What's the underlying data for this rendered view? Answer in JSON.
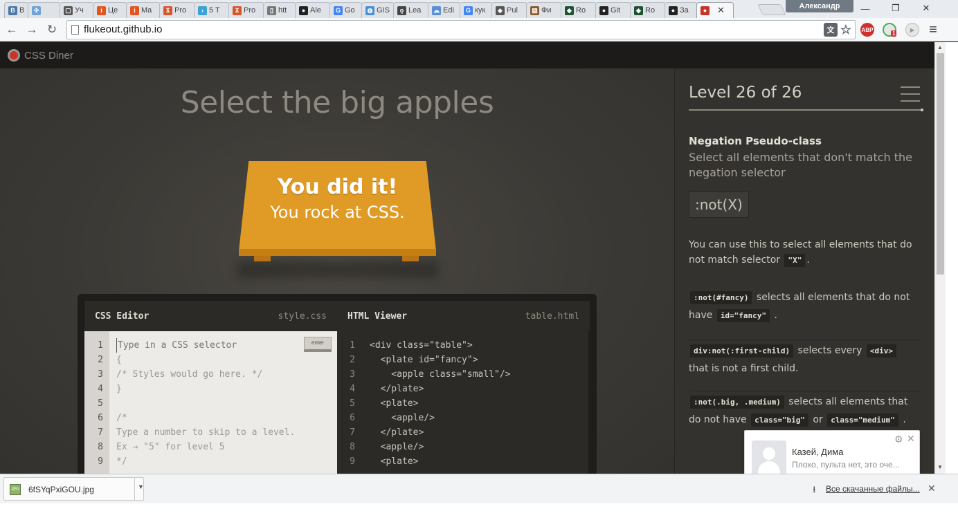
{
  "browser": {
    "tabs": [
      {
        "label": "В",
        "favicon_color": "#4a76a8",
        "favicon_char": "В"
      },
      {
        "label": "",
        "favicon_color": "#6aa4d8",
        "favicon_char": "✣"
      },
      {
        "label": "Уч",
        "favicon_color": "#555555",
        "favicon_char": "▢"
      },
      {
        "label": "Це",
        "favicon_color": "#e2551f",
        "favicon_char": "i"
      },
      {
        "label": "Ma",
        "favicon_color": "#e2551f",
        "favicon_char": "i"
      },
      {
        "label": "Pro",
        "favicon_color": "#d9542b",
        "favicon_char": "Ϫ"
      },
      {
        "label": "5 T",
        "favicon_color": "#3aa3d6",
        "favicon_char": "›"
      },
      {
        "label": "Pro",
        "favicon_color": "#d9542b",
        "favicon_char": "Ϫ"
      },
      {
        "label": "htt",
        "favicon_color": "#777777",
        "favicon_char": "▯"
      },
      {
        "label": "Ale",
        "favicon_color": "#222222",
        "favicon_char": "●"
      },
      {
        "label": "Go",
        "favicon_color": "#4285f4",
        "favicon_char": "G"
      },
      {
        "label": "GIS",
        "favicon_color": "#4a90d9",
        "favicon_char": "◍"
      },
      {
        "label": "Lea",
        "favicon_color": "#444444",
        "favicon_char": "ǫ"
      },
      {
        "label": "Edi",
        "favicon_color": "#5a8fd6",
        "favicon_char": "☁"
      },
      {
        "label": "кук",
        "favicon_color": "#4285f4",
        "favicon_char": "G"
      },
      {
        "label": "Pul",
        "favicon_color": "#555555",
        "favicon_char": "◈"
      },
      {
        "label": "Фи",
        "favicon_color": "#8a5a2b",
        "favicon_char": "▤"
      },
      {
        "label": "Ro",
        "favicon_color": "#1f5233",
        "favicon_char": "◆"
      },
      {
        "label": "Git",
        "favicon_color": "#222222",
        "favicon_char": "●"
      },
      {
        "label": "Ro",
        "favicon_color": "#1f5233",
        "favicon_char": "◆"
      },
      {
        "label": "За",
        "favicon_color": "#222222",
        "favicon_char": "●"
      },
      {
        "label": "",
        "favicon_color": "#c7342a",
        "favicon_char": "●",
        "active": true,
        "close": "✕"
      }
    ],
    "profile_name": "Александр",
    "window_buttons": {
      "minimize": "—",
      "maximize": "❐",
      "close": "✕"
    },
    "nav": {
      "back": "←",
      "forward": "→",
      "reload": "↻"
    },
    "url": "flukeout.github.io",
    "extensions": {
      "translate": "文",
      "star": "☆",
      "abp": "ABP",
      "badge": "1",
      "menu": "≡"
    }
  },
  "page": {
    "logo_text": "CSS Diner",
    "level_title": "Select the big apples",
    "success": {
      "title": "You did it!",
      "subtitle": "You rock at CSS."
    },
    "css_editor": {
      "title": "CSS Editor",
      "file": "style.css",
      "placeholder": "Type in a CSS selector",
      "enter_label": "enter",
      "line_numbers": [
        "1",
        "2",
        "3",
        "4",
        "5",
        "6",
        "7",
        "8",
        "9"
      ],
      "lines": [
        "",
        "{",
        "/* Styles would go here. */",
        "}",
        "",
        "/*",
        "Type a number to skip to a level.",
        "Ex → \"5\" for level 5",
        "*/"
      ]
    },
    "html_viewer": {
      "title": "HTML Viewer",
      "file": "table.html",
      "line_numbers": [
        "1",
        "2",
        "3",
        "4",
        "5",
        "6",
        "7",
        "8",
        "9"
      ],
      "lines": [
        "<div class=\"table\">",
        "  <plate id=\"fancy\">",
        "    <apple class=\"small\"/>",
        "  </plate>",
        "  <plate>",
        "    <apple/>",
        "  </plate>",
        "  <apple/>",
        "  <plate>"
      ]
    },
    "sidebar": {
      "level_indicator": "Level 26 of 26",
      "progress_fraction": 1.0,
      "title": "Negation Pseudo-class",
      "subtitle": "Select all elements that don't match the negation selector",
      "syntax": ":not(X)",
      "desc_pre": "You can use this to select all elements that do not match selector",
      "desc_code": "\"X\"",
      "desc_post": ".",
      "examples": [
        {
          "code": ":not(#fancy)",
          "text": "selects all elements that do not have",
          "code2": "id=\"fancy\"",
          "text2": "."
        },
        {
          "code": "div:not(:first-child)",
          "text": "selects every",
          "code2": "<div>",
          "text2": "that is not a first child."
        },
        {
          "code": ":not(.big, .medium)",
          "text": "selects all elements that do not have",
          "code2": "class=\"big\"",
          "mid": "or",
          "code3": "class=\"medium\"",
          "text2": "."
        }
      ]
    }
  },
  "notification": {
    "name": "Казей, Дима",
    "message": "Плохо, пульта нет, это оче...",
    "gear": "⚙",
    "close": "✕"
  },
  "downloads": {
    "file_name": "6fSYqPxiGOU.jpg",
    "file_type": "JPG",
    "show_all": "Все скачанные файлы...",
    "close": "✕"
  }
}
